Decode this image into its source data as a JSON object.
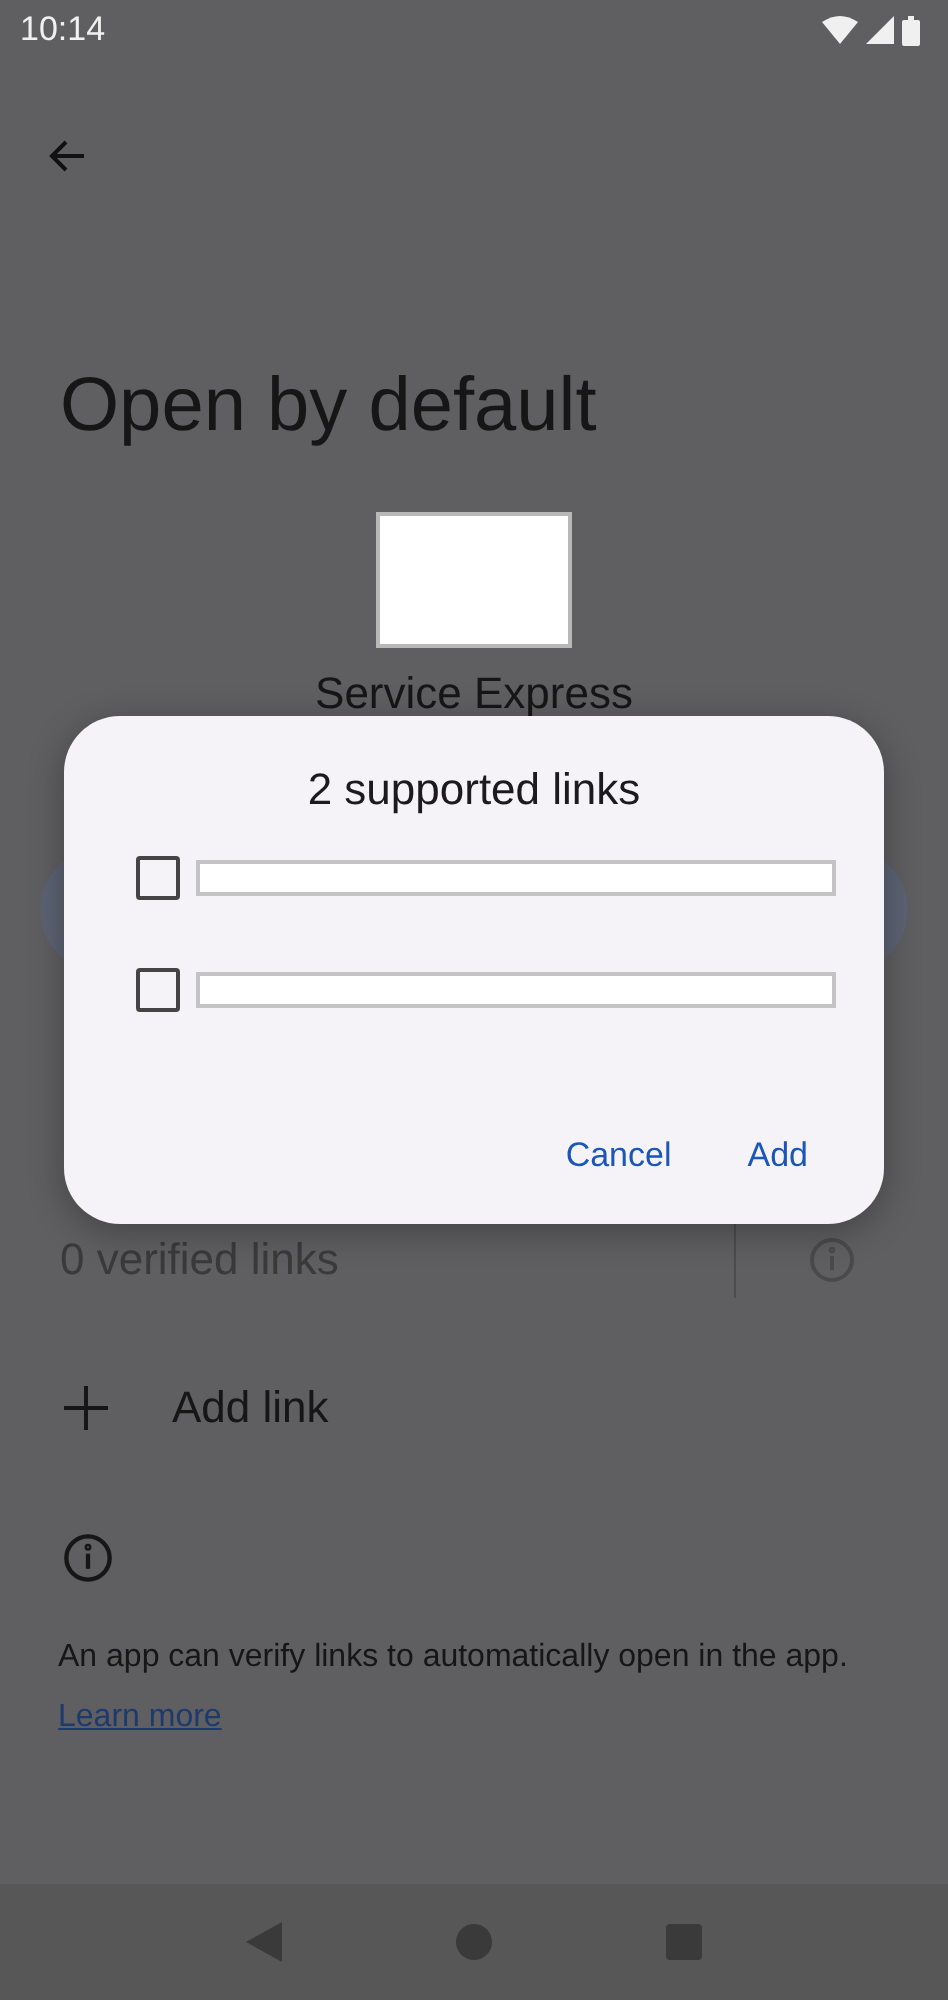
{
  "status_bar": {
    "time": "10:14"
  },
  "title": "Open by default",
  "app": {
    "name": "Service Express"
  },
  "verified": {
    "label": "0 verified links",
    "disabled": true
  },
  "add_link": {
    "label": "Add link"
  },
  "info": {
    "text": "An app can verify links to automatically open in the app.",
    "link": "Learn more"
  },
  "dialog": {
    "title": "2 supported links",
    "links": [
      {
        "checked": false,
        "redacted": true
      },
      {
        "checked": false,
        "redacted": true
      }
    ],
    "buttons": [
      "Cancel",
      "Add"
    ]
  }
}
